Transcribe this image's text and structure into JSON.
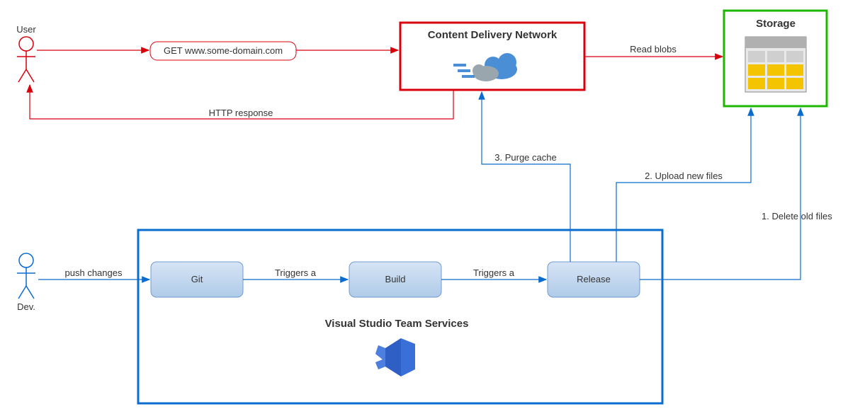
{
  "actors": {
    "user": "User",
    "dev": "Dev."
  },
  "request": {
    "label": "GET www.some-domain.com"
  },
  "cdn": {
    "title": "Content Delivery Network"
  },
  "storage": {
    "title": "Storage"
  },
  "vsts": {
    "title": "Visual Studio Team Services",
    "nodes": {
      "git": "Git",
      "build": "Build",
      "release": "Release"
    }
  },
  "edges": {
    "http_response": "HTTP response",
    "read_blobs": "Read blobs",
    "push_changes": "push changes",
    "triggers_a_1": "Triggers a",
    "triggers_a_2": "Triggers a",
    "purge_cache": "3. Purge cache",
    "upload_new": "2. Upload new files",
    "delete_old": "1. Delete old files"
  }
}
